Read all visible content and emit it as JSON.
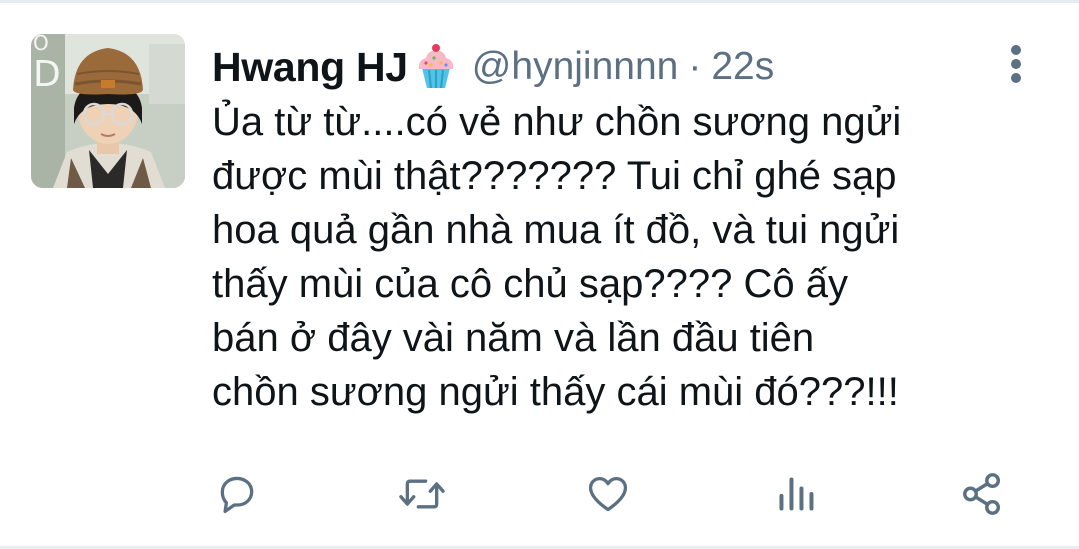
{
  "tweet": {
    "display_name": "Hwang HJ",
    "badge_icon": "cupcake-emoji",
    "handle": "@hynjinnnn",
    "separator": "·",
    "time": "22s",
    "text": "Ủa từ từ....có vẻ như chồn sương ngửi\nđược mùi thật??????? Tui chỉ ghé sạp\nhoa quả gần nhà mua ít đồ, và tui ngửi\nthấy mùi của cô chủ sạp???? Cô ấy\nbán ở đây vài năm và lần đầu tiên\nchồn sương ngửi thấy cái mùi đó???!!!"
  },
  "actions": [
    {
      "icon": "reply-icon"
    },
    {
      "icon": "retweet-icon"
    },
    {
      "icon": "like-icon"
    },
    {
      "icon": "analytics-icon"
    },
    {
      "icon": "share-icon"
    }
  ],
  "colors": {
    "text": "#0f1419",
    "secondary": "#5b7083",
    "icon": "#5b7083",
    "divider": "#e6ecf0"
  }
}
